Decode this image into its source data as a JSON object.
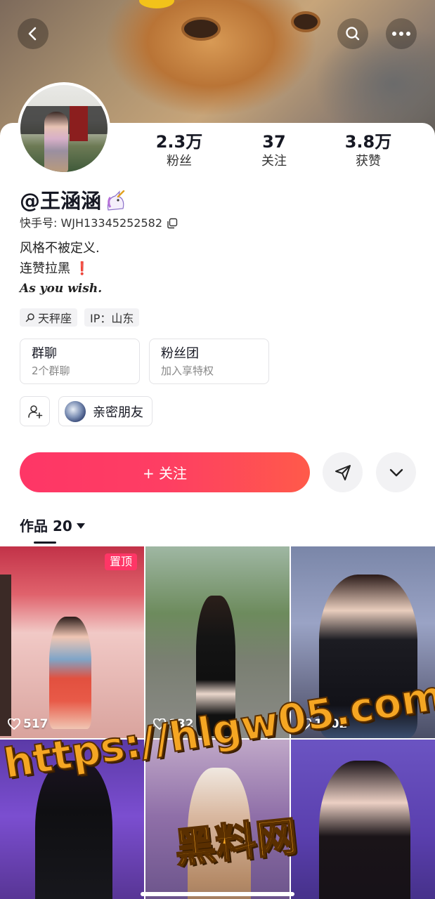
{
  "profile": {
    "nickname": "@王涵涵",
    "kuaishou_id": "快手号: WJH13345252582",
    "bio_lines": [
      "风格不被定义.",
      "连赞拉黑",
      "As you wish."
    ],
    "tags": [
      "天秤座",
      "IP：山东"
    ]
  },
  "stats": [
    {
      "value": "2.3万",
      "label": "粉丝"
    },
    {
      "value": "37",
      "label": "关注"
    },
    {
      "value": "3.8万",
      "label": "获赞"
    }
  ],
  "group_boxes": [
    {
      "title": "群聊",
      "sub": "2个群聊"
    },
    {
      "title": "粉丝团",
      "sub": "加入享特权"
    }
  ],
  "close_friends": "亲密朋友",
  "follow_button": "+ 关注",
  "works_tab": "作品 20",
  "grid": [
    {
      "pinned": "置顶",
      "likes": "517"
    },
    {
      "likes": "132"
    },
    {
      "likes": "1602"
    },
    {},
    {},
    {}
  ],
  "watermark": {
    "url": "https://hlgw05.com",
    "name": "黑料网"
  },
  "colors": {
    "accent": "#fe3666",
    "watermark": "#f5a623"
  },
  "icons": [
    "back-arrow-icon",
    "search-icon",
    "more-dots-icon",
    "copy-icon",
    "search-tag-icon",
    "add-friend-icon",
    "share-icon",
    "chevron-down-icon",
    "caret-down-icon",
    "heart-icon"
  ]
}
